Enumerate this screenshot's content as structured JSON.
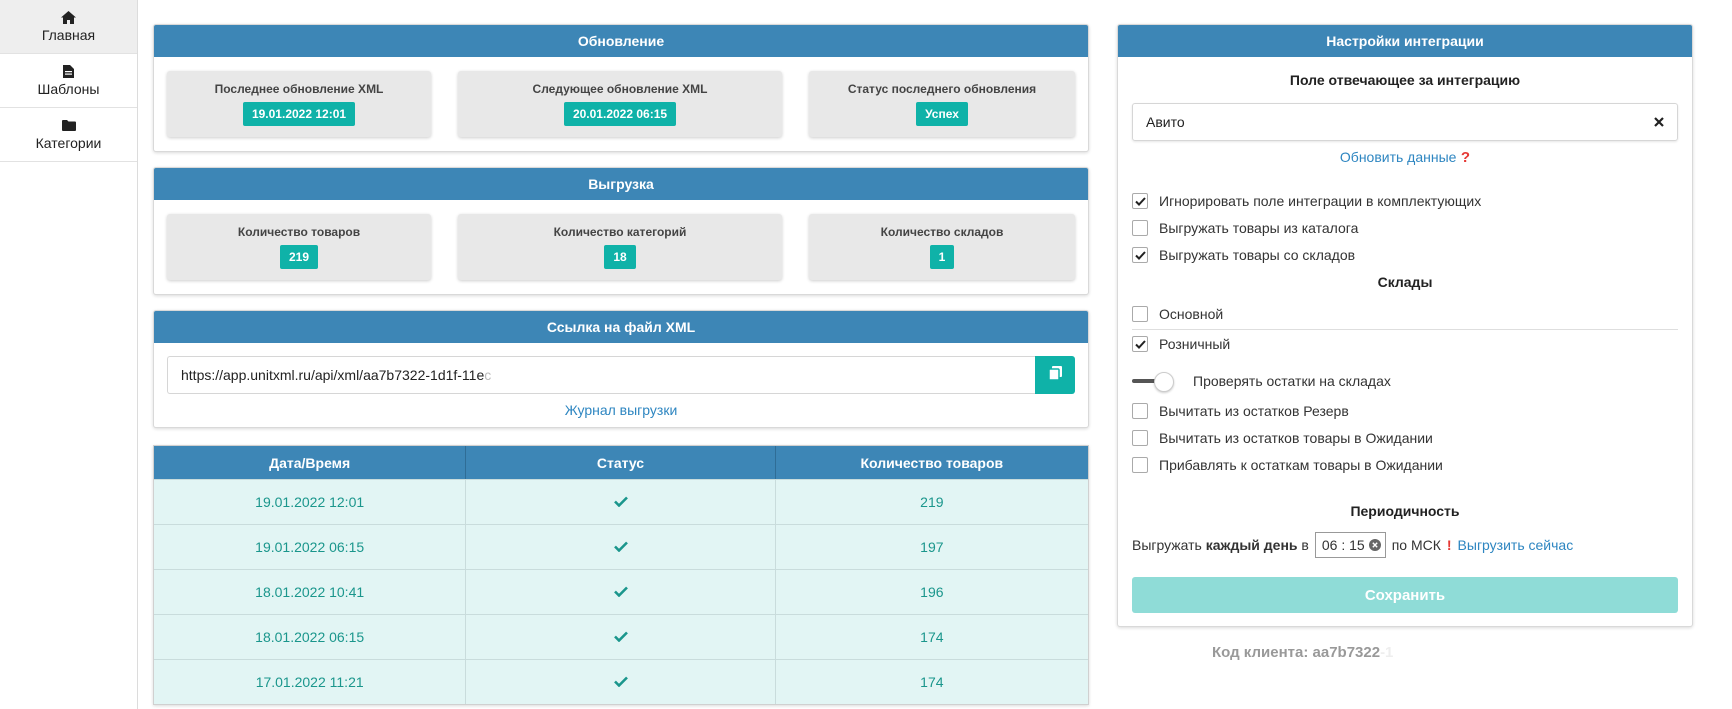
{
  "sidebar": {
    "items": [
      {
        "label": "Главная",
        "icon": "home-icon"
      },
      {
        "label": "Шаблоны",
        "icon": "file-icon"
      },
      {
        "label": "Категории",
        "icon": "folder-icon"
      }
    ]
  },
  "update": {
    "title": "Обновление",
    "last_label": "Последнее обновление XML",
    "last_value": "19.01.2022 12:01",
    "next_label": "Следующее обновление XML",
    "next_value": "20.01.2022 06:15",
    "status_label": "Статус последнего обновления",
    "status_value": "Успех"
  },
  "export": {
    "title": "Выгрузка",
    "products_label": "Количество товаров",
    "products_value": "219",
    "categories_label": "Количество категорий",
    "categories_value": "18",
    "warehouses_label": "Количество складов",
    "warehouses_value": "1"
  },
  "xml_link": {
    "title": "Ссылка на файл XML",
    "url_visible": "https://app.unitxml.ru/api/xml/aa7b7322-1d1f-11e",
    "url_faded": "c",
    "log_link": "Журнал выгрузки"
  },
  "history": {
    "headers": [
      "Дата/Время",
      "Статус",
      "Количество товаров"
    ],
    "rows": [
      {
        "datetime": "19.01.2022 12:01",
        "count": "219"
      },
      {
        "datetime": "19.01.2022 06:15",
        "count": "197"
      },
      {
        "datetime": "18.01.2022 10:41",
        "count": "196"
      },
      {
        "datetime": "18.01.2022 06:15",
        "count": "174"
      },
      {
        "datetime": "17.01.2022 11:21",
        "count": "174"
      }
    ]
  },
  "settings": {
    "title": "Настройки интеграции",
    "field_title": "Поле отвечающее за интеграцию",
    "field_value": "Авито",
    "refresh_link": "Обновить данные",
    "options": [
      {
        "label": "Игнорировать поле интеграции в комплектующих",
        "checked": true
      },
      {
        "label": "Выгружать товары из каталога",
        "checked": false
      },
      {
        "label": "Выгружать товары со складов",
        "checked": true
      }
    ],
    "warehouses_title": "Склады",
    "warehouses": [
      {
        "label": "Основной",
        "checked": false
      },
      {
        "label": "Розничный",
        "checked": true
      }
    ],
    "check_stock_label": "Проверять остатки на складах",
    "stock_options": [
      {
        "label": "Вычитать из остатков Резерв",
        "checked": false
      },
      {
        "label": "Вычитать из остатков товары в Ожидании",
        "checked": false
      },
      {
        "label": "Прибавлять к остаткам товары в Ожидании",
        "checked": false
      }
    ],
    "period_title": "Периодичность",
    "period_prefix": "Выгружать",
    "period_bold": "каждый день",
    "period_in": "в",
    "time_value": "06 : 15",
    "period_tz": "по МСК",
    "export_now": "Выгрузить сейчас",
    "save_label": "Сохранить"
  },
  "client": {
    "label": "Код клиента: aa7b7322",
    "faded": "-1"
  },
  "colors": {
    "header_blue": "#3d86b6",
    "teal": "#0fb2a8",
    "row_bg": "#e2f5f4",
    "link": "#2e86c1"
  }
}
